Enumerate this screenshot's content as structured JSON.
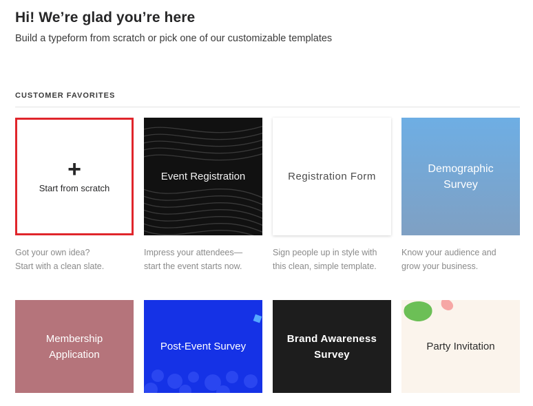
{
  "header": {
    "title": "Hi! We’re glad you’re here",
    "subtitle": "Build a typeform from scratch or pick one of our customizable templates"
  },
  "section": {
    "label": "CUSTOMER FAVORITES"
  },
  "cards": [
    {
      "title": "Start from scratch",
      "icon": "plus-icon",
      "highlight_color": "#e0252b",
      "desc1": "Got your own idea?",
      "desc2": "Start with a clean slate."
    },
    {
      "title": "Event Registration",
      "bg": "#111111",
      "desc1": "Impress your attendees—",
      "desc2": "start the event starts now."
    },
    {
      "title": "Registration Form",
      "bg": "#ffffff",
      "desc1": "Sign people up in style with",
      "desc2": "this clean, simple template."
    },
    {
      "title1": "Demographic",
      "title2": "Survey",
      "bg": "#72aee0",
      "desc1": "Know your audience and",
      "desc2": "grow your business."
    },
    {
      "title1": "Membership",
      "title2": "Application",
      "bg": "#b5747b"
    },
    {
      "title": "Post-Event Survey",
      "bg": "#1532e6"
    },
    {
      "title1": "Brand Awareness",
      "title2": "Survey",
      "bg": "#1d1d1d"
    },
    {
      "title": "Party Invitation",
      "bg": "#fbf4ec"
    }
  ]
}
